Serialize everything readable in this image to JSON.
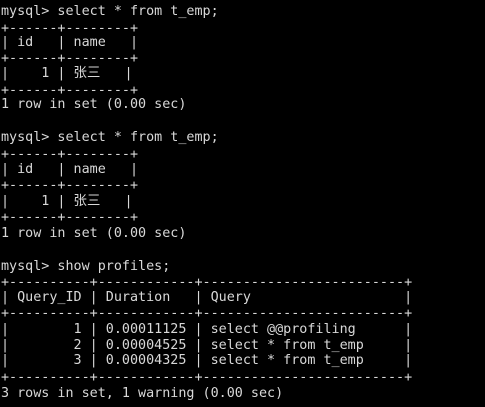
{
  "terminal": {
    "lines": [
      "mysql> select * from t_emp;",
      "+------+--------+",
      "| id   | name   |",
      "+------+--------+",
      "|    1 | 张三   |",
      "+------+--------+",
      "1 row in set (0.00 sec)",
      "",
      "mysql> select * from t_emp;",
      "+------+--------+",
      "| id   | name   |",
      "+------+--------+",
      "|    1 | 张三   |",
      "+------+--------+",
      "1 row in set (0.00 sec)",
      "",
      "mysql> show profiles;",
      "+----------+------------+-------------------------+",
      "| Query_ID | Duration   | Query                   |",
      "+----------+------------+-------------------------+",
      "|        1 | 0.00011125 | select @@profiling      |",
      "|        2 | 0.00004525 | select * from t_emp     |",
      "|        3 | 0.00004325 | select * from t_emp     |",
      "+----------+------------+-------------------------+",
      "3 rows in set, 1 warning (0.00 sec)"
    ]
  },
  "colors": {
    "background": "#000000",
    "text": "#d8d8d8"
  }
}
